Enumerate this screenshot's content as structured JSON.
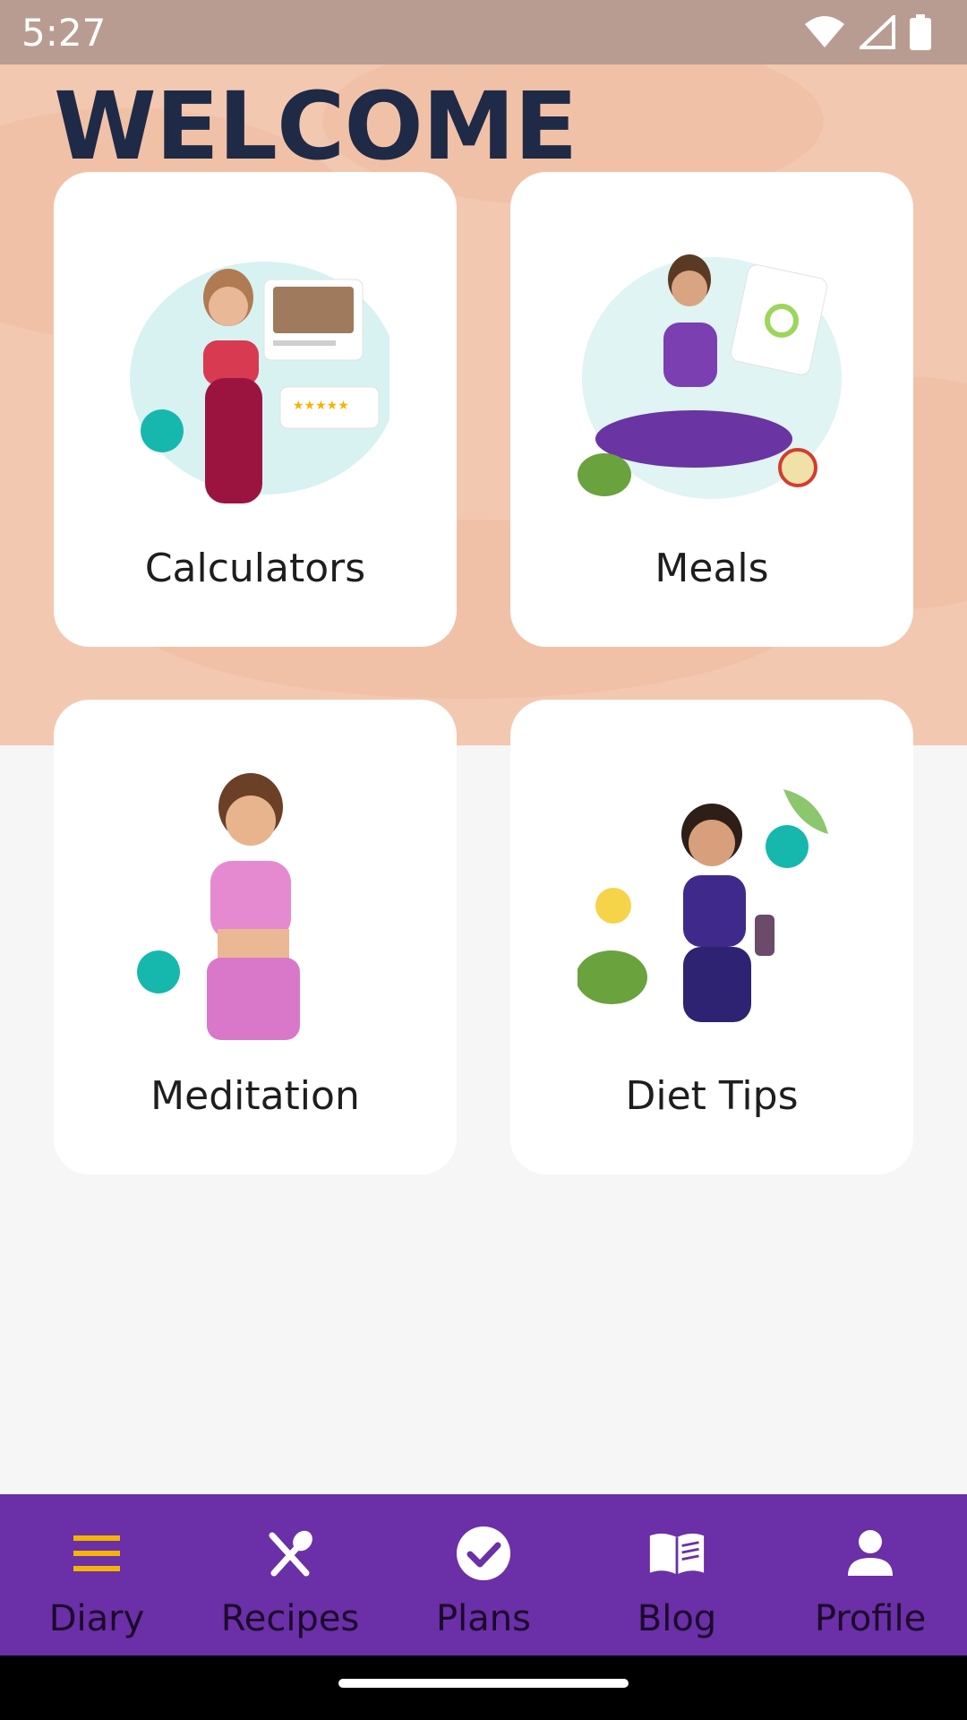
{
  "status_bar": {
    "time": "5:27",
    "icons": [
      "wifi-icon",
      "signal-icon",
      "battery-icon"
    ]
  },
  "header": {
    "title": "WELCOME"
  },
  "cards": [
    {
      "label": "Calculators",
      "illustration": "woman-fitness-illustration"
    },
    {
      "label": "Meals",
      "illustration": "woman-sitting-meals-illustration"
    },
    {
      "label": "Meditation",
      "illustration": "woman-thinking-illustration"
    },
    {
      "label": "Diet Tips",
      "illustration": "woman-drink-illustration"
    }
  ],
  "bottom_nav": {
    "items": [
      {
        "label": "Diary",
        "icon": "menu-icon",
        "active": true
      },
      {
        "label": "Recipes",
        "icon": "fork-spoon-icon",
        "active": false
      },
      {
        "label": "Plans",
        "icon": "check-circle-icon",
        "active": false
      },
      {
        "label": "Blog",
        "icon": "book-icon",
        "active": false
      },
      {
        "label": "Profile",
        "icon": "person-icon",
        "active": false
      }
    ]
  },
  "colors": {
    "hero_background": "#f3c8b0",
    "nav_background": "#6b2fa8",
    "active_icon": "#f5b400",
    "title": "#1f2a46",
    "accent_teal": "#16b8ad"
  }
}
